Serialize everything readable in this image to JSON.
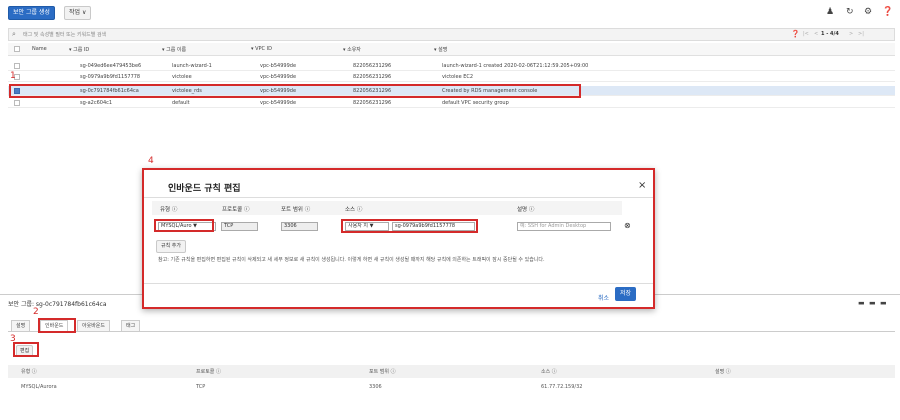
{
  "toolbar": {
    "create_button": "보안 그룹 생성",
    "actions_button": "작업 ∨"
  },
  "search": {
    "placeholder": "태그 및 속성별 필터 또는 키워드별 검색",
    "pagination": "1 - 4/4"
  },
  "table": {
    "headers": [
      "Name",
      "그룹 ID",
      "그룹 이름",
      "VPC ID",
      "소유자",
      "설명"
    ],
    "rows": [
      {
        "group_id": "sg-049ed6ee479453be6",
        "group_name": "launch-wizard-1",
        "vpc_id": "vpc-b54999de",
        "owner": "822056231296",
        "description": "launch-wizard-1 created 2020-02-06T21:12:59.205+09:00"
      },
      {
        "group_id": "sg-0979a9b9fd1157778",
        "group_name": "victolee",
        "vpc_id": "vpc-b54999de",
        "owner": "822056231296",
        "description": "victolee EC2"
      },
      {
        "group_id": "sg-0c791784fb61c64ca",
        "group_name": "victolee_rds",
        "vpc_id": "vpc-b54999de",
        "owner": "822056231296",
        "description": "Created by RDS management console"
      },
      {
        "group_id": "sg-a2c604c1",
        "group_name": "default",
        "vpc_id": "vpc-b54999de",
        "owner": "822056231296",
        "description": "default VPC security group"
      }
    ]
  },
  "annotations": {
    "n1": "1",
    "n2": "2",
    "n3": "3",
    "n4": "4"
  },
  "modal": {
    "title": "인바운드 규칙 편집",
    "close": "×",
    "headers": {
      "type": "유형 ⓘ",
      "protocol": "프로토콜 ⓘ",
      "port": "포트 범위 ⓘ",
      "source": "소스 ⓘ",
      "desc": "설명 ⓘ"
    },
    "row": {
      "type": "MYSQL/Auro ▼",
      "protocol": "TCP",
      "port": "3306",
      "source_type": "사용자 지 ▼",
      "source": "sg-0979a9b9fd1157778",
      "desc_placeholder": "예: SSH for Admin Desktop"
    },
    "add_rule": "규칙 추가",
    "note": "참고: 기존 규칙을 편집하면 편집된 규칙이 삭제되고 새 세부 정보로 새 규칙이 생성됩니다. 이렇게 하면 새 규칙이 생성될 때까지 해당 규칙에 의존하는 트래픽이 잠시 중단될 수 있습니다.",
    "cancel": "취소",
    "save": "저장"
  },
  "lower": {
    "title": "보안 그룹: sg-0c791784fb61c64ca",
    "tabs": [
      "설명",
      "인바운드",
      "아웃바운드",
      "태그"
    ],
    "edit_button": "편집",
    "headers": [
      "유형 ⓘ",
      "프로토콜 ⓘ",
      "포트 범위 ⓘ",
      "소스 ⓘ",
      "설명 ⓘ"
    ],
    "row": {
      "type": "MYSQL/Aurora",
      "protocol": "TCP",
      "port": "3306",
      "source": "61.77.72.159/32"
    }
  },
  "colors": {
    "accent": "#2b6cc4",
    "highlight": "#d42a2a",
    "selected_row": "#dde8f6"
  }
}
